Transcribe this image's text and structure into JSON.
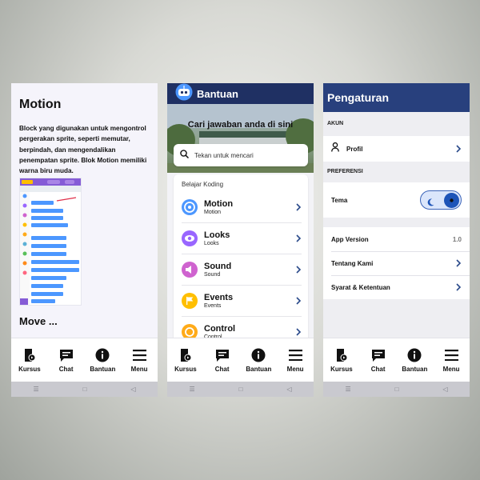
{
  "nav": {
    "items": [
      {
        "label": "Kursus",
        "icon": "book-play-icon"
      },
      {
        "label": "Chat",
        "icon": "chat-icon"
      },
      {
        "label": "Bantuan",
        "icon": "info-icon"
      },
      {
        "label": "Menu",
        "icon": "hamburger-icon"
      }
    ]
  },
  "system_nav": {
    "icons": [
      "recent-apps-icon",
      "home-icon",
      "back-icon"
    ]
  },
  "motion_screen": {
    "title": "Motion",
    "description": "Block yang digunakan untuk mengontrol pergerakan sprite, seperti memutar, berpindah, dan mengendalikan penempatan sprite. Blok Motion memiliki warna biru muda.",
    "next_heading": "Move ...",
    "accent_color": "#4c97ff"
  },
  "help_screen": {
    "header_title": "Bantuan",
    "hero_title": "Cari jawaban anda di sini",
    "search_placeholder": "Tekan untuk mencari",
    "card_heading": "Belajar Koding",
    "courses": [
      {
        "name": "Motion",
        "subtitle": "Motion",
        "color": "#4c97ff",
        "icon": "motion-icon"
      },
      {
        "name": "Looks",
        "subtitle": "Looks",
        "color": "#9966ff",
        "icon": "eye-icon"
      },
      {
        "name": "Sound",
        "subtitle": "Sound",
        "color": "#cf63cf",
        "icon": "speaker-icon"
      },
      {
        "name": "Events",
        "subtitle": "Events",
        "color": "#ffbf00",
        "icon": "flag-icon"
      },
      {
        "name": "Control",
        "subtitle": "Control",
        "color": "#ffab19",
        "icon": "control-icon"
      }
    ],
    "header_color": "#1f3063"
  },
  "settings_screen": {
    "header_title": "Pengaturan",
    "section_account": "AKUN",
    "profile_label": "Profil",
    "section_preferences": "PREFERENSI",
    "theme_label": "Tema",
    "app_version_label": "App Version",
    "app_version_value": "1.0",
    "about_label": "Tentang Kami",
    "terms_label": "Syarat & Ketentuan",
    "header_color": "#28407d"
  }
}
